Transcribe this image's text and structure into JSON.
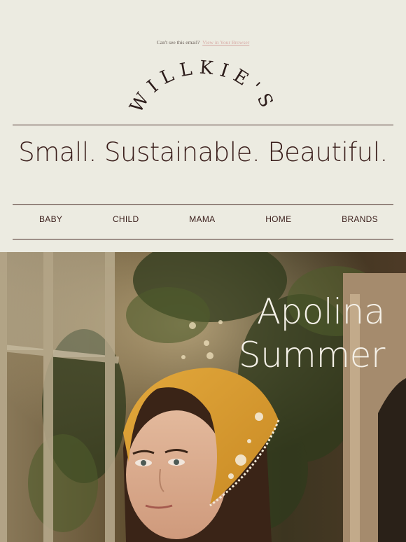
{
  "header": {
    "preheader_text": "Can't see this email?",
    "preheader_link": "View in Your Browser",
    "brand": "WILLKIE'S"
  },
  "tagline": "Small. Sustainable. Beautiful.",
  "nav": {
    "items": [
      "BABY",
      "CHILD",
      "MAMA",
      "HOME",
      "BRANDS"
    ]
  },
  "hero": {
    "title_line1": "Apolina",
    "title_line2": "Summer"
  },
  "colors": {
    "background": "#ecebe1",
    "text": "#3b1f1c",
    "link": "#d7a9a4",
    "hero_text": "#f5f1e8"
  }
}
